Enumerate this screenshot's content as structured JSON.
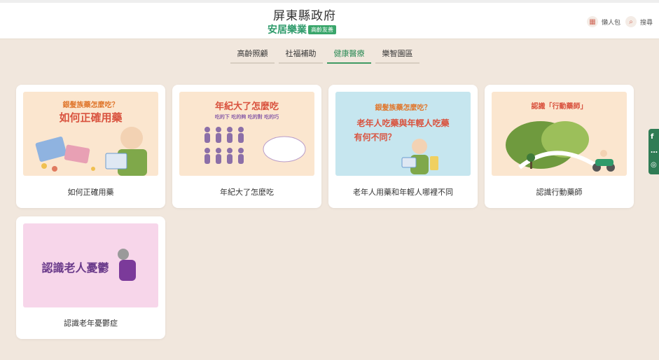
{
  "header": {
    "logo_line1": "屏東縣政府",
    "logo_line2": "安居樂業",
    "logo_badge": "高齡友善",
    "lazy_pack_label": "懶人包",
    "search_label": "搜尋"
  },
  "tabs": [
    {
      "label": "高齡照顧",
      "active": false
    },
    {
      "label": "社福補助",
      "active": false
    },
    {
      "label": "健康醫療",
      "active": true
    },
    {
      "label": "樂智園區",
      "active": false
    }
  ],
  "cards": [
    {
      "caption": "如何正確用藥",
      "thumb_top": "銀髮族藥怎麼吃？",
      "thumb_title": "如何正確用藥",
      "bg": "#fbe6cf"
    },
    {
      "caption": "年紀大了怎麼吃",
      "thumb_top": "年紀大了怎麼吃",
      "thumb_sub": "吃的下 吃的夠 吃的對 吃的巧",
      "bg": "#fbe6cf"
    },
    {
      "caption": "老年人用藥和年輕人哪裡不同",
      "thumb_top": "銀髮族藥怎麼吃？",
      "thumb_title": "老年人吃藥與年輕人吃藥",
      "thumb_title2": "有何不同？",
      "bg": "#c6e6ef"
    },
    {
      "caption": "認識行動藥師",
      "thumb_top": "認識「行動藥師」",
      "bg": "#fbe6cf"
    },
    {
      "caption": "認識老年憂鬱症",
      "thumb_title": "認識老人憂鬱",
      "bg": "#f7d6ea"
    }
  ],
  "social": [
    "f",
    "…",
    "◎"
  ]
}
